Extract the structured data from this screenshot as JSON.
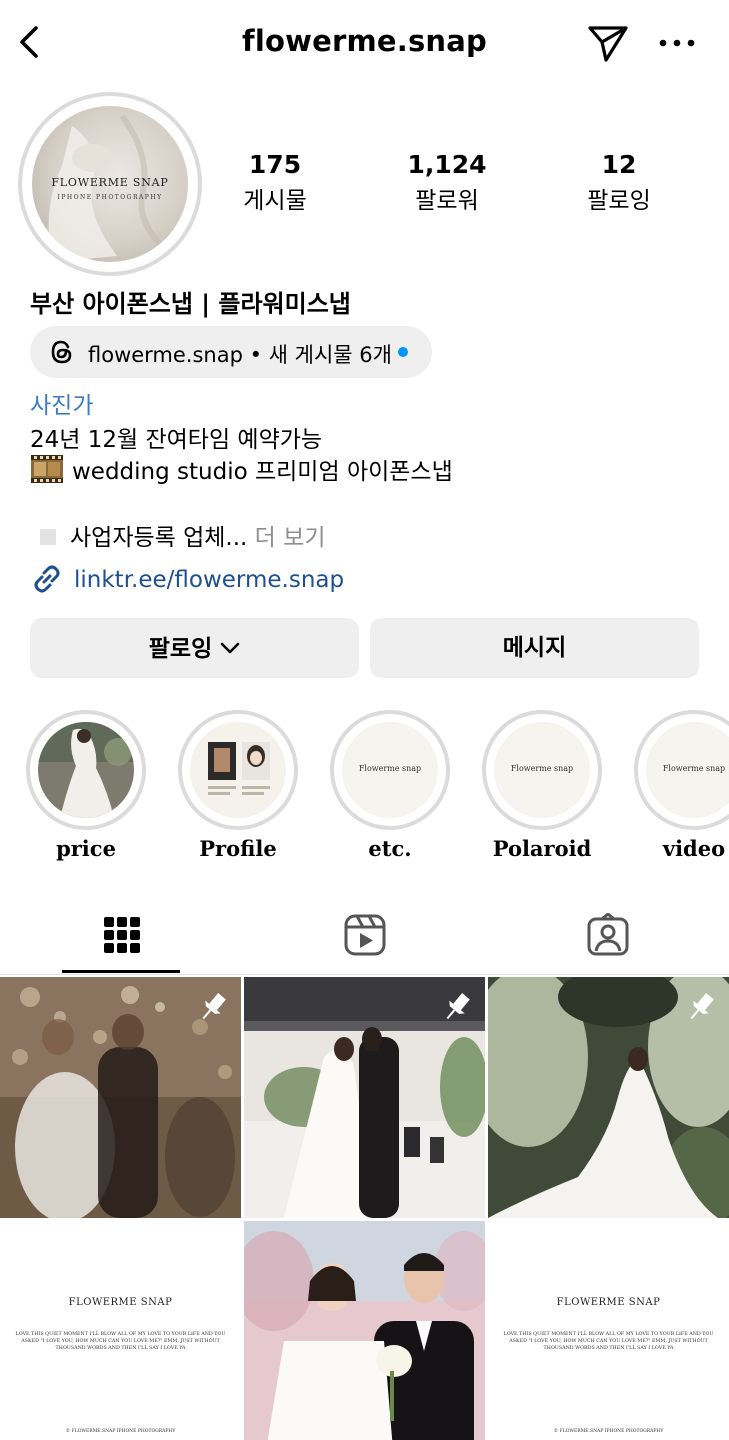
{
  "header": {
    "username": "flowerme.snap"
  },
  "avatar": {
    "brand": "FLOWERME SNAP",
    "subtitle": "IPHONE PHOTOGRAPHY"
  },
  "stats": [
    {
      "value": "175",
      "label": "게시물"
    },
    {
      "value": "1,124",
      "label": "팔로워"
    },
    {
      "value": "12",
      "label": "팔로잉"
    }
  ],
  "profile": {
    "name": "부산 아이폰스냅 | 플라워미스냅",
    "threads_text": "flowerme.snap • 새 게시물 6개",
    "category": "사진가",
    "bio_line1": "24년 12월 잔여타임 예약가능",
    "bio_line2": "wedding studio 프리미엄 아이폰스냅",
    "bio_line3": "사업자등록 업체...",
    "more": " 더 보기",
    "link": "linktr.ee/flowerme.snap"
  },
  "actions": {
    "following_label": "팔로잉",
    "message_label": "메시지"
  },
  "highlights": [
    {
      "label": "price",
      "cover": "photo"
    },
    {
      "label": "Profile",
      "cover": "photo"
    },
    {
      "label": "etc.",
      "cover": "brand",
      "brand": "Flowerme snap"
    },
    {
      "label": "Polaroid",
      "cover": "brand",
      "brand": "Flowerme snap"
    },
    {
      "label": "video",
      "cover": "brand",
      "brand": "Flowerme snap"
    }
  ],
  "tabs": [
    {
      "icon": "grid-icon",
      "active": true
    },
    {
      "icon": "reels-icon",
      "active": false
    },
    {
      "icon": "tagged-icon",
      "active": false
    }
  ],
  "grid_cards": {
    "brand": "FLOWERME SNAP",
    "quote": "LOVE THIS QUIET MOMENT I'LL BLOW ALL OF MY LOVE TO YOUR LIFE AND YOU ASKED \"I LOVE YOU, HOW MUCH CAN YOU LOVE ME?\" EMM, JUST WITHOUT THOUSAND WORDS AND THEN I'LL SAY I LOVE YA",
    "footer": "© FLOWERME.SNAP IPHONE PHOTOGRAPHY"
  },
  "colors": {
    "link": "#1d4f91",
    "threads_dot": "#0095f6",
    "button_bg": "#efefef"
  }
}
